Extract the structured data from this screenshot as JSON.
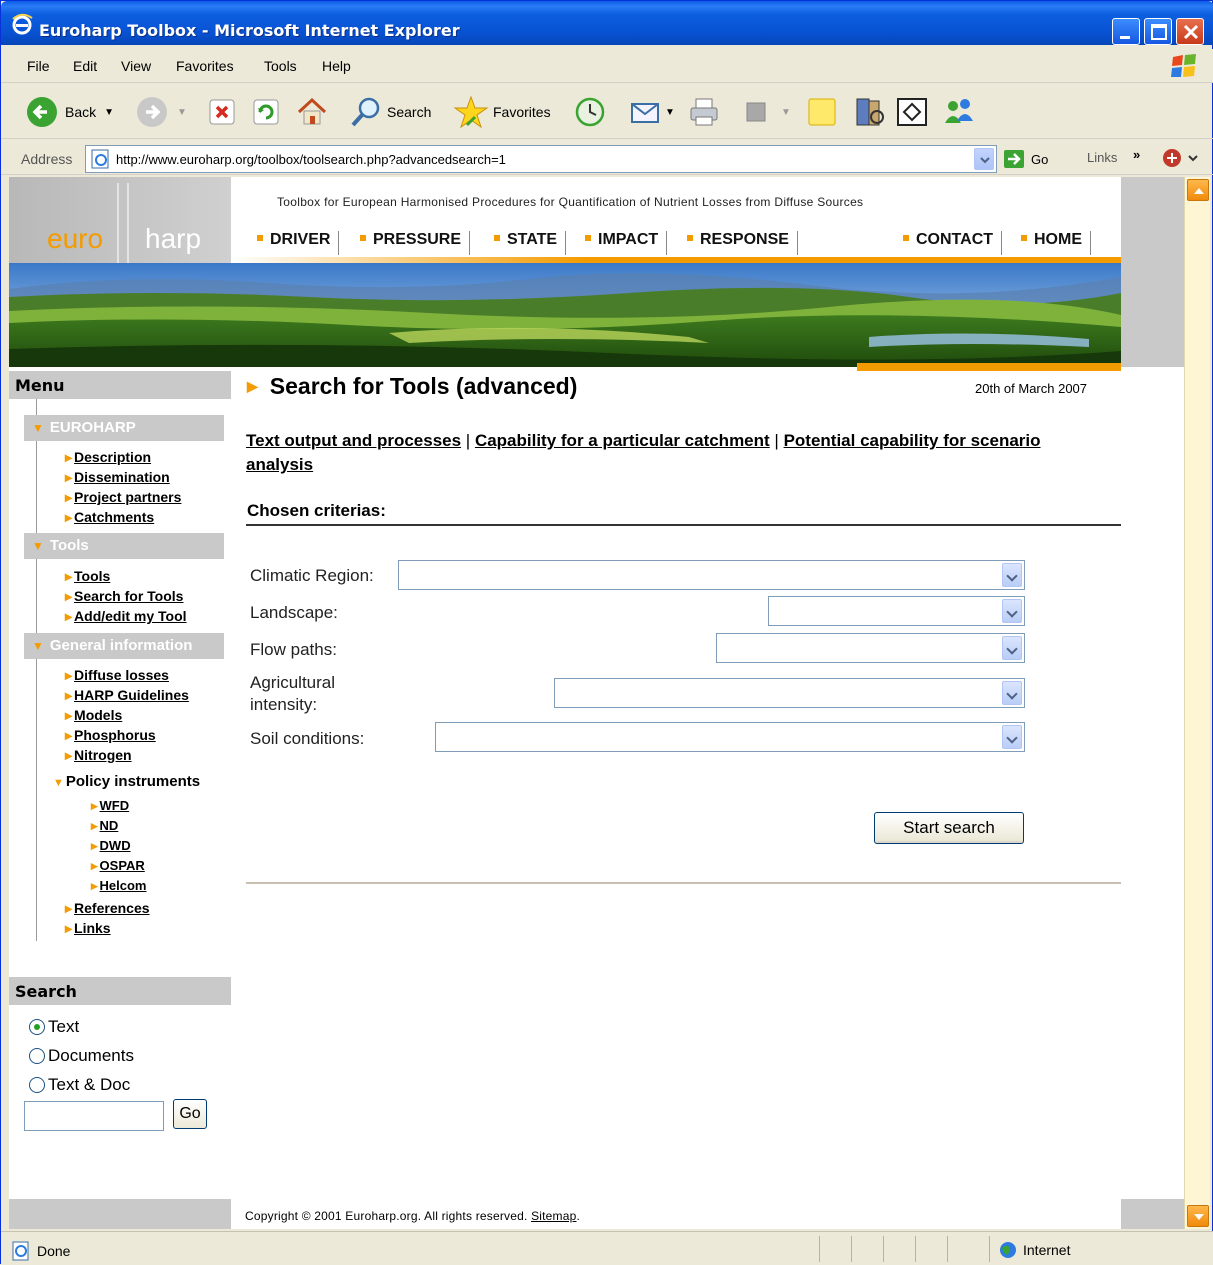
{
  "window": {
    "title": "Euroharp Toolbox - Microsoft Internet Explorer"
  },
  "menubar": {
    "items": [
      "File",
      "Edit",
      "View",
      "Favorites",
      "Tools",
      "Help"
    ]
  },
  "toolbar": {
    "back_label": "Back",
    "search_label": "Search",
    "favorites_label": "Favorites"
  },
  "addressbar": {
    "label": "Address",
    "url": "http://www.euroharp.org/toolbox/toolsearch.php?advancedsearch=1",
    "go_label": "Go",
    "links_label": "Links"
  },
  "header": {
    "logo_euro": "euro",
    "logo_harp": "harp",
    "tagline": "Toolbox for European Harmonised Procedures for Quantification of Nutrient Losses from Diffuse Sources",
    "nav": [
      "DRIVER",
      "PRESSURE",
      "STATE",
      "IMPACT",
      "RESPONSE",
      "CONTACT",
      "HOME"
    ]
  },
  "sidebar": {
    "menu_title": "Menu",
    "sections": [
      {
        "title": "EUROHARP",
        "items": [
          "Description",
          "Dissemination",
          "Project partners",
          "Catchments"
        ]
      },
      {
        "title": "Tools",
        "items": [
          "Tools",
          "Search for Tools",
          "Add/edit my Tool"
        ]
      },
      {
        "title": "General information",
        "items": [
          "Diffuse losses",
          "HARP Guidelines",
          "Models",
          "Phosphorus",
          "Nitrogen"
        ]
      }
    ],
    "policy": {
      "title": "Policy instruments",
      "items": [
        "WFD",
        "ND",
        "DWD",
        "OSPAR",
        "Helcom"
      ]
    },
    "after_policy": [
      "References",
      "Links"
    ],
    "search": {
      "title": "Search",
      "options": [
        "Text",
        "Documents",
        "Text & Doc"
      ],
      "selected": "Text",
      "go_label": "Go"
    }
  },
  "main": {
    "title": "Search for Tools (advanced)",
    "date": "20th of March 2007",
    "tabs": [
      "Text output and processes",
      "Capability for a particular catchment",
      "Potential capability for scenario analysis"
    ],
    "criteria_title": "Chosen criterias:",
    "fields": [
      {
        "label": "Climatic Region:",
        "value": ""
      },
      {
        "label": "Landscape:",
        "value": ""
      },
      {
        "label": "Flow paths:",
        "value": ""
      },
      {
        "label": "Agricultural intensity:",
        "value": ""
      },
      {
        "label": "Soil conditions:",
        "value": ""
      }
    ],
    "search_button": "Start search"
  },
  "footer": {
    "copyright": "Copyright © 2001 Euroharp.org. All rights reserved.",
    "sitemap": "Sitemap"
  },
  "statusbar": {
    "status": "Done",
    "zone": "Internet"
  }
}
